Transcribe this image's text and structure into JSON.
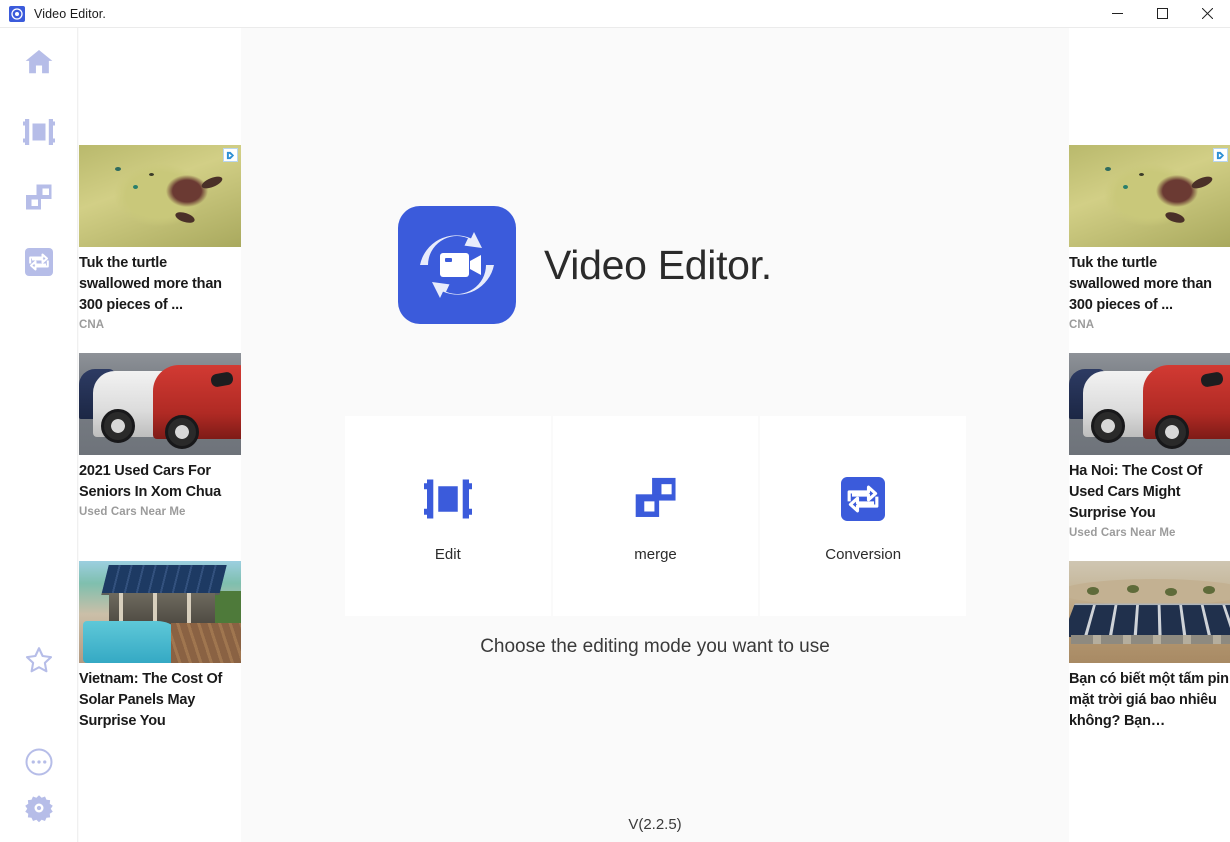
{
  "window": {
    "title": "Video Editor.",
    "app_icon": "video-editor-icon",
    "minimize_label": "Minimize",
    "maximize_label": "Maximize",
    "close_label": "Close"
  },
  "sidebar": {
    "top_items": [
      {
        "id": "home",
        "icon": "home-icon",
        "label": "Home"
      },
      {
        "id": "edit",
        "icon": "film-strip-icon",
        "label": "Edit"
      },
      {
        "id": "merge",
        "icon": "merge-squares-icon",
        "label": "Merge"
      },
      {
        "id": "conversion",
        "icon": "conversion-icon",
        "label": "Conversion"
      }
    ],
    "bottom_items": [
      {
        "id": "favorite",
        "icon": "star-icon",
        "label": "Favorite"
      },
      {
        "id": "more",
        "icon": "more-dots-icon",
        "label": "More"
      },
      {
        "id": "settings",
        "icon": "gear-icon",
        "label": "Settings"
      }
    ]
  },
  "brand": {
    "logo_icon": "video-camera-refresh-icon",
    "name": "Video Editor.",
    "accent_color": "#3b5bdb"
  },
  "main": {
    "modes": [
      {
        "id": "edit",
        "icon": "film-strip-icon",
        "label": "Edit"
      },
      {
        "id": "merge",
        "icon": "merge-squares-icon",
        "label": "merge"
      },
      {
        "id": "conversion",
        "icon": "conversion-icon",
        "label": "Conversion"
      }
    ],
    "hint": "Choose the editing mode you want to use",
    "version": "V(2.2.5)"
  },
  "ads": {
    "adchoices_icon": "adchoices-icon",
    "left": [
      {
        "art": "art-turtle",
        "title": "Tuk the turtle swallowed more than 300 pieces of ...",
        "source": "CNA",
        "has_adchoices": true
      },
      {
        "art": "art-cars",
        "title": "2021 Used Cars For Seniors In Xom Chua",
        "source": "Used Cars Near Me",
        "has_adchoices": false
      },
      {
        "art": "art-solar",
        "title": "Vietnam: The Cost Of Solar Panels May Surprise You",
        "source": "",
        "has_adchoices": false
      }
    ],
    "right": [
      {
        "art": "art-turtle",
        "title": "Tuk the turtle swallowed more than 300 pieces of ...",
        "source": "CNA",
        "has_adchoices": true
      },
      {
        "art": "art-cars",
        "title": "Ha Noi: The Cost Of Used Cars Might Surprise You",
        "source": "Used Cars Near Me",
        "has_adchoices": false
      },
      {
        "art": "art-desert",
        "title": "Bạn có biết một tấm pin mặt trời giá bao nhiêu không? Bạn…",
        "source": "",
        "has_adchoices": false
      }
    ]
  }
}
